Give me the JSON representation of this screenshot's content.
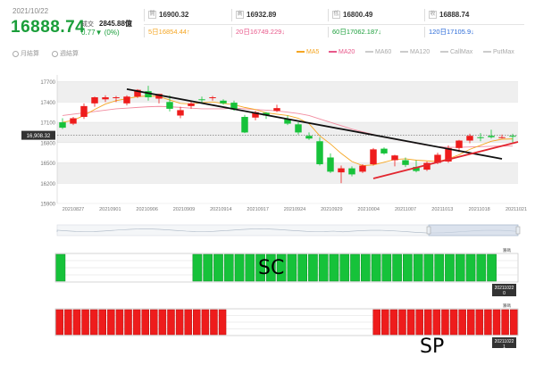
{
  "header": {
    "date": "2021/10/22",
    "price": "16888.74",
    "volume_label": "成交",
    "volume_value": "2845.88億",
    "change": "0.77▼ (0%)",
    "open_tag": "開",
    "open": "16900.32",
    "high_tag": "高",
    "high": "16932.89",
    "low_tag": "低",
    "low": "16800.49",
    "close_tag": "收",
    "close": "16888.74",
    "ma5": "5日16854.44↑",
    "ma20": "20日16749.229↓",
    "ma60": "60日17062.187↓",
    "ma120": "120日17105.9↓"
  },
  "options": {
    "monthly": "月結算",
    "weekly": "週結算"
  },
  "legend": [
    "MA5",
    "MA20",
    "MA60",
    "MA120",
    "CallMax",
    "PutMax"
  ],
  "colors": {
    "up": "#ee1c1c",
    "down": "#16c23a",
    "ma5": "#f5a623",
    "ma20": "#f28ca0",
    "trend_down": "#111111",
    "trend_up": "#e2262f",
    "price_green": "#1a9e3a"
  },
  "chart_data": {
    "type": "candlestick",
    "ylim": [
      15900,
      17800
    ],
    "yticks": [
      15900,
      16200,
      16500,
      16800,
      17100,
      17400,
      17700
    ],
    "ytick_labels": [
      "15900",
      "16200",
      "16500",
      "16800",
      "17100",
      "17400",
      "17700"
    ],
    "current_price_label": "16,908.32",
    "current_price": 16908,
    "xtick_labels": [
      "20210827",
      "20210901",
      "20210906",
      "20210909",
      "20210914",
      "20210917",
      "20210924",
      "20210929",
      "20210004",
      "20211007",
      "20211013",
      "20211018",
      "20211021"
    ],
    "candles": [
      {
        "o": 17100,
        "h": 17160,
        "l": 17000,
        "c": 17020
      },
      {
        "o": 17080,
        "h": 17180,
        "l": 17060,
        "c": 17160
      },
      {
        "o": 17180,
        "h": 17380,
        "l": 17150,
        "c": 17340
      },
      {
        "o": 17380,
        "h": 17480,
        "l": 17330,
        "c": 17470
      },
      {
        "o": 17440,
        "h": 17500,
        "l": 17400,
        "c": 17470
      },
      {
        "o": 17460,
        "h": 17490,
        "l": 17400,
        "c": 17470
      },
      {
        "o": 17380,
        "h": 17500,
        "l": 17350,
        "c": 17480
      },
      {
        "o": 17480,
        "h": 17590,
        "l": 17460,
        "c": 17580
      },
      {
        "o": 17560,
        "h": 17640,
        "l": 17420,
        "c": 17470
      },
      {
        "o": 17450,
        "h": 17520,
        "l": 17380,
        "c": 17520
      },
      {
        "o": 17400,
        "h": 17500,
        "l": 17260,
        "c": 17300
      },
      {
        "o": 17200,
        "h": 17330,
        "l": 17160,
        "c": 17280
      },
      {
        "o": 17340,
        "h": 17420,
        "l": 17300,
        "c": 17380
      },
      {
        "o": 17440,
        "h": 17480,
        "l": 17380,
        "c": 17430
      },
      {
        "o": 17460,
        "h": 17490,
        "l": 17420,
        "c": 17470
      },
      {
        "o": 17420,
        "h": 17440,
        "l": 17360,
        "c": 17380
      },
      {
        "o": 17390,
        "h": 17420,
        "l": 17270,
        "c": 17290
      },
      {
        "o": 17180,
        "h": 17210,
        "l": 16940,
        "c": 16950
      },
      {
        "o": 17170,
        "h": 17270,
        "l": 17130,
        "c": 17250
      },
      {
        "o": 17240,
        "h": 17250,
        "l": 17150,
        "c": 17200
      },
      {
        "o": 17270,
        "h": 17360,
        "l": 17250,
        "c": 17310
      },
      {
        "o": 17150,
        "h": 17200,
        "l": 17060,
        "c": 17080
      },
      {
        "o": 17070,
        "h": 17100,
        "l": 16920,
        "c": 16950
      },
      {
        "o": 16900,
        "h": 16950,
        "l": 16840,
        "c": 16860
      },
      {
        "o": 16820,
        "h": 16880,
        "l": 16460,
        "c": 16480
      },
      {
        "o": 16580,
        "h": 16640,
        "l": 16350,
        "c": 16370
      },
      {
        "o": 16360,
        "h": 16460,
        "l": 16200,
        "c": 16420
      },
      {
        "o": 16420,
        "h": 16450,
        "l": 16300,
        "c": 16330
      },
      {
        "o": 16370,
        "h": 16480,
        "l": 16350,
        "c": 16460
      },
      {
        "o": 16480,
        "h": 16720,
        "l": 16460,
        "c": 16700
      },
      {
        "o": 16710,
        "h": 16730,
        "l": 16620,
        "c": 16640
      },
      {
        "o": 16540,
        "h": 16620,
        "l": 16450,
        "c": 16610
      },
      {
        "o": 16540,
        "h": 16580,
        "l": 16440,
        "c": 16470
      },
      {
        "o": 16440,
        "h": 16540,
        "l": 16360,
        "c": 16380
      },
      {
        "o": 16400,
        "h": 16520,
        "l": 16380,
        "c": 16500
      },
      {
        "o": 16500,
        "h": 16650,
        "l": 16480,
        "c": 16620
      },
      {
        "o": 16520,
        "h": 16760,
        "l": 16500,
        "c": 16720
      },
      {
        "o": 16720,
        "h": 16840,
        "l": 16660,
        "c": 16830
      },
      {
        "o": 16830,
        "h": 16930,
        "l": 16790,
        "c": 16900
      },
      {
        "o": 16880,
        "h": 16940,
        "l": 16820,
        "c": 16870
      },
      {
        "o": 16900,
        "h": 16990,
        "l": 16860,
        "c": 16880
      },
      {
        "o": 16880,
        "h": 16920,
        "l": 16860,
        "c": 16880
      },
      {
        "o": 16900,
        "h": 16930,
        "l": 16800,
        "c": 16889
      }
    ],
    "ma5": [
      17100,
      17130,
      17200,
      17290,
      17370,
      17420,
      17450,
      17480,
      17490,
      17480,
      17430,
      17380,
      17370,
      17390,
      17400,
      17380,
      17360,
      17320,
      17290,
      17240,
      17220,
      17200,
      17160,
      17080,
      16900,
      16780,
      16640,
      16520,
      16460,
      16470,
      16510,
      16550,
      16560,
      16540,
      16530,
      16520,
      16560,
      16620,
      16700,
      16760,
      16820,
      16850,
      16855
    ],
    "ma20": [
      17200,
      17220,
      17240,
      17260,
      17280,
      17300,
      17310,
      17320,
      17330,
      17335,
      17330,
      17320,
      17310,
      17300,
      17300,
      17300,
      17310,
      17300,
      17290,
      17280,
      17270,
      17250,
      17230,
      17200,
      17150,
      17100,
      17050,
      17000,
      16960,
      16920,
      16880,
      16850,
      16820,
      16790,
      16760,
      16740,
      16730,
      16730,
      16735,
      16740,
      16745,
      16750,
      16749
    ],
    "trend_down": {
      "from": [
        6,
        17590
      ],
      "to": [
        41,
        16560
      ]
    },
    "trend_up": {
      "from": [
        29,
        16270
      ],
      "to": [
        43,
        16810
      ]
    }
  },
  "navigator_label_left": "",
  "indicators": {
    "sc": {
      "label": "SC",
      "flag": "",
      "pattern": [
        1,
        0,
        0,
        0,
        0,
        0,
        0,
        0,
        0,
        0,
        0,
        0,
        0,
        1,
        1,
        1,
        1,
        1,
        1,
        1,
        1,
        1,
        1,
        1,
        1,
        1,
        1,
        1,
        1,
        1,
        1,
        1,
        1,
        1,
        1,
        1,
        1,
        1,
        1,
        1,
        1,
        1,
        0,
        0
      ],
      "corner_label": "籌碼",
      "date_label": "20211022",
      "date_sub": "0"
    },
    "sp": {
      "label": "SP",
      "flag": "",
      "pattern": [
        1,
        1,
        1,
        1,
        1,
        1,
        1,
        1,
        1,
        1,
        1,
        1,
        1,
        1,
        1,
        1,
        1,
        1,
        1,
        1,
        0,
        0,
        0,
        0,
        0,
        0,
        0,
        0,
        0,
        0,
        0,
        0,
        0,
        0,
        0,
        0,
        0,
        1,
        1,
        1,
        1,
        1,
        1,
        1,
        1,
        1,
        1,
        1,
        1,
        1,
        1,
        1,
        1,
        1
      ],
      "corner_label": "籌碼",
      "date_label": "20211022",
      "date_sub": "1"
    }
  }
}
